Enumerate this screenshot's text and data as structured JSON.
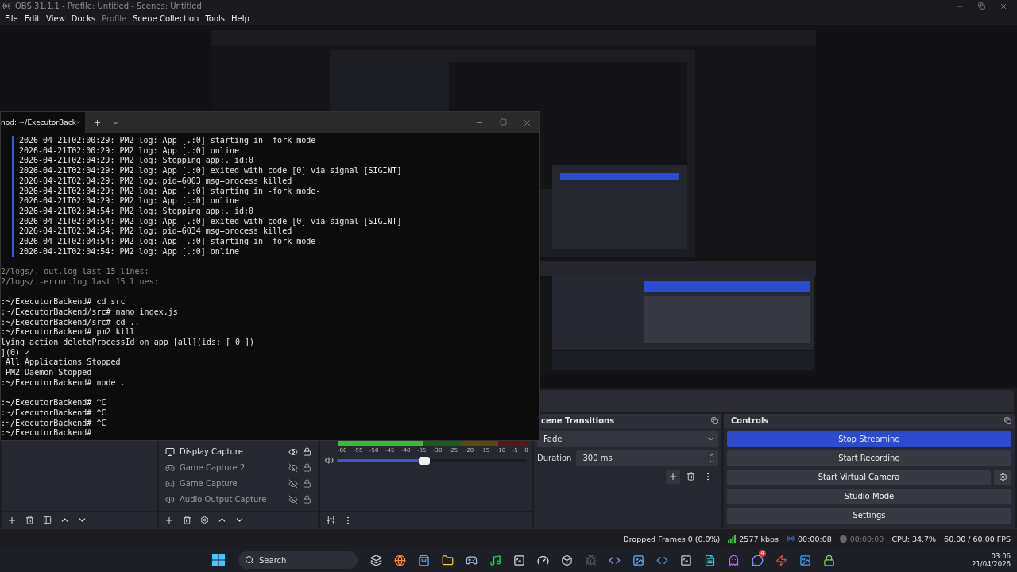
{
  "window": {
    "title": "OBS 31.1.1 - Profile: Untitled - Scenes: Untitled"
  },
  "menu": [
    {
      "label": "File",
      "disabled": false
    },
    {
      "label": "Edit",
      "disabled": false
    },
    {
      "label": "View",
      "disabled": false
    },
    {
      "label": "Docks",
      "disabled": false
    },
    {
      "label": "Profile",
      "disabled": true
    },
    {
      "label": "Scene Collection",
      "disabled": false
    },
    {
      "label": "Tools",
      "disabled": false
    },
    {
      "label": "Help",
      "disabled": false
    }
  ],
  "terminal": {
    "tab_title": "nod: ~/ExecutorBack",
    "lines": [
      {
        "kind": "log",
        "text": "2026-04-21T02:00:29: PM2 log: App [.:0] starting in -fork mode-"
      },
      {
        "kind": "log",
        "text": "2026-04-21T02:00:29: PM2 log: App [.:0] online"
      },
      {
        "kind": "log",
        "text": "2026-04-21T02:04:29: PM2 log: Stopping app:. id:0"
      },
      {
        "kind": "log",
        "text": "2026-04-21T02:04:29: PM2 log: App [.:0] exited with code [0] via signal [SIGINT]"
      },
      {
        "kind": "log",
        "text": "2026-04-21T02:04:29: PM2 log: pid=6003 msg=process killed"
      },
      {
        "kind": "log",
        "text": "2026-04-21T02:04:29: PM2 log: App [.:0] starting in -fork mode-"
      },
      {
        "kind": "log",
        "text": "2026-04-21T02:04:29: PM2 log: App [.:0] online"
      },
      {
        "kind": "log",
        "text": "2026-04-21T02:04:54: PM2 log: Stopping app:. id:0"
      },
      {
        "kind": "log",
        "text": "2026-04-21T02:04:54: PM2 log: App [.:0] exited with code [0] via signal [SIGINT]"
      },
      {
        "kind": "log",
        "text": "2026-04-21T02:04:54: PM2 log: pid=6034 msg=process killed"
      },
      {
        "kind": "log",
        "text": "2026-04-21T02:04:54: PM2 log: App [.:0] starting in -fork mode-"
      },
      {
        "kind": "log",
        "text": "2026-04-21T02:04:54: PM2 log: App [.:0] online"
      },
      {
        "kind": "dim",
        "text": "2/logs/.-out.log last 15 lines:",
        "spaced": true
      },
      {
        "kind": "dim",
        "text": "2/logs/.-error.log last 15 lines:"
      },
      {
        "kind": "plain",
        "text": ":~/ExecutorBackend# cd src",
        "spaced": true
      },
      {
        "kind": "plain",
        "text": ":~/ExecutorBackend/src# nano index.js"
      },
      {
        "kind": "plain",
        "text": ":~/ExecutorBackend/src# cd .."
      },
      {
        "kind": "plain",
        "text": ":~/ExecutorBackend# pm2 kill"
      },
      {
        "kind": "plain",
        "text": "lying action deleteProcessId on app [all](ids: [ 0 ])"
      },
      {
        "kind": "plain",
        "text": "](0) ✓"
      },
      {
        "kind": "plain",
        "text": " All Applications Stopped"
      },
      {
        "kind": "plain",
        "text": " PM2 Daemon Stopped"
      },
      {
        "kind": "plain",
        "text": ":~/ExecutorBackend# node ."
      },
      {
        "kind": "plain",
        "text": ":~/ExecutorBackend# ^C",
        "spaced": true
      },
      {
        "kind": "plain",
        "text": ":~/ExecutorBackend# ^C"
      },
      {
        "kind": "plain",
        "text": ":~/ExecutorBackend# ^C"
      },
      {
        "kind": "plain",
        "text": ":~/ExecutorBackend#"
      }
    ]
  },
  "sources": [
    {
      "kind": "display",
      "name": "Display Capture",
      "visible": true
    },
    {
      "kind": "game",
      "name": "Game Capture 2",
      "visible": false
    },
    {
      "kind": "game",
      "name": "Game Capture",
      "visible": false
    },
    {
      "kind": "audio",
      "name": "Audio Output Capture",
      "visible": false
    }
  ],
  "mixer": {
    "meter": {
      "level": 0.45
    },
    "scale": [
      "-60",
      "-55",
      "-50",
      "-45",
      "-40",
      "-35",
      "-30",
      "-25",
      "-20",
      "-15",
      "-10",
      "-5",
      "0"
    ],
    "volume": {
      "level": 0.46
    }
  },
  "transitions": {
    "title": "cene Transitions",
    "type": "Fade",
    "duration_label": "Duration",
    "duration": "300 ms"
  },
  "controls": {
    "title": "Controls",
    "buttons": [
      {
        "label": "Stop Streaming",
        "active": true,
        "kind": "plain"
      },
      {
        "label": "Start Recording",
        "active": false,
        "kind": "plain"
      },
      {
        "label": "Start Virtual Camera",
        "active": false,
        "kind": "split"
      },
      {
        "label": "Studio Mode",
        "active": false,
        "kind": "plain"
      },
      {
        "label": "Settings",
        "active": false,
        "kind": "plain"
      }
    ]
  },
  "status_bar": {
    "dropped": "Dropped Frames 0 (0.0%)",
    "bitrate": "2577 kbps",
    "stream_time": "00:00:08",
    "record_time": "00:00:00",
    "cpu": "CPU: 34.7%",
    "fps": "60.00 / 60.00 FPS"
  },
  "taskbar": {
    "search": "Search",
    "chat_badge": "4",
    "time": "03:06",
    "date": "21/04/2026"
  }
}
